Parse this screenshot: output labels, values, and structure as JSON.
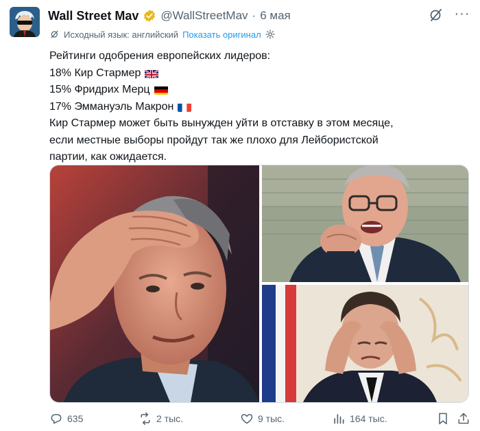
{
  "author": {
    "name": "Wall Street Mav",
    "handle": "@WallStreetMav",
    "separator": "·",
    "date": "6 мая"
  },
  "translation": {
    "source_language": "Исходный язык: английский",
    "show_original": "Показать оригинал"
  },
  "tweet": {
    "heading": "Рейтинги одобрения европейских лидеров:",
    "ratings": [
      {
        "text": "18% Кир Стармер",
        "flag": "uk-flag"
      },
      {
        "text": "15% Фридрих Мерц",
        "flag": "germany-flag"
      },
      {
        "text": "17% Эммануэль Макрон",
        "flag": "france-flag"
      }
    ],
    "body_lines": [
      "Кир Стармер может быть вынужден уйти в отставку в этом месяце,",
      "если местные выборы пройдут так же плохо для Лейбористской",
      "партии, как ожидается."
    ]
  },
  "stats": {
    "replies": "635",
    "retweets": "2 тыс.",
    "likes": "9 тыс.",
    "views": "164 тыс."
  },
  "colors": {
    "accent": "#1d9bf0",
    "muted": "#536471",
    "verified_badge": "#e8b71a"
  }
}
